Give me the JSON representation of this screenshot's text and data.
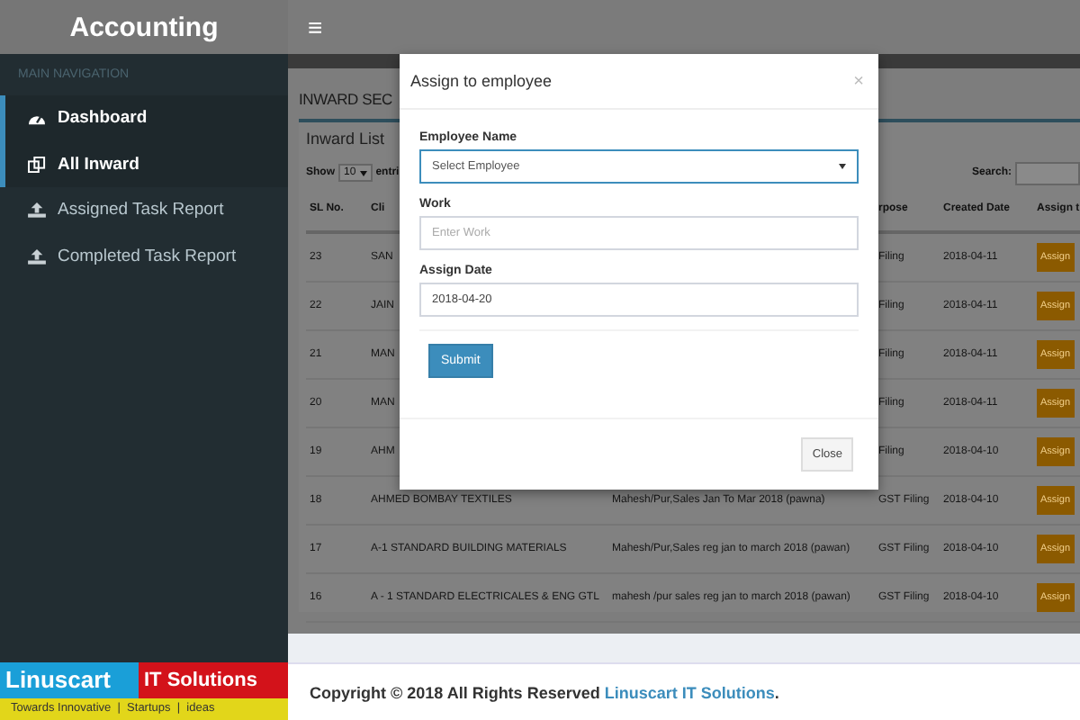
{
  "header": {
    "brand": "Accounting",
    "menu_icon": "≡"
  },
  "sidebar": {
    "heading": "MAIN NAVIGATION",
    "items": [
      {
        "label": "Dashboard",
        "selected": true
      },
      {
        "label": "All Inward",
        "selected": true
      },
      {
        "label": "Assigned Task Report",
        "selected": false
      },
      {
        "label": "Completed Task Report",
        "selected": false
      }
    ]
  },
  "logo": {
    "name": "Linuscart",
    "suffix": "IT Solutions",
    "tagline": "Towards Innovative  |  Startups  |  ideas"
  },
  "page": {
    "title": "INWARD SEC",
    "box_title": "Inward List",
    "show_label": "Show",
    "page_size": "10",
    "entries_label": "entri",
    "search_label": "Search:"
  },
  "table": {
    "columns": [
      "SL No.",
      "Cli",
      "",
      "rpose",
      "Created Date",
      "Assign t"
    ],
    "rows": [
      {
        "sl": "23",
        "client": "SAN",
        "purpose": "Filing",
        "date": "2018-04-11",
        "action": "Assign"
      },
      {
        "sl": "22",
        "client": "JAIN",
        "purpose": "Filing",
        "date": "2018-04-11",
        "action": "Assign"
      },
      {
        "sl": "21",
        "client": "MAN",
        "purpose": "Filing",
        "date": "2018-04-11",
        "action": "Assign"
      },
      {
        "sl": "20",
        "client": "MAN",
        "purpose": "Filing",
        "date": "2018-04-11",
        "action": "Assign"
      },
      {
        "sl": "19",
        "client": "AHM",
        "purpose": "Filing",
        "date": "2018-04-10",
        "action": "Assign"
      },
      {
        "sl": "18",
        "client": "AHMED BOMBAY TEXTILES",
        "work": "Mahesh/Pur,Sales Jan To Mar 2018 (pawna)",
        "purpose": "GST Filing",
        "date": "2018-04-10",
        "action": "Assign"
      },
      {
        "sl": "17",
        "client": "A-1 STANDARD BUILDING MATERIALS",
        "work": "Mahesh/Pur,Sales reg jan to march 2018 (pawan)",
        "purpose": "GST Filing",
        "date": "2018-04-10",
        "action": "Assign"
      },
      {
        "sl": "16",
        "client": "A - 1 STANDARD ELECTRICALES & ENG GTL",
        "work": "mahesh /pur sales reg jan to march 2018 (pawan)",
        "purpose": "GST Filing",
        "date": "2018-04-10",
        "action": "Assign"
      }
    ]
  },
  "modal": {
    "title": "Assign to employee",
    "close_icon": "×",
    "fields": [
      {
        "label": "Employee Name",
        "kind": "select",
        "placeholder": "Select Employee",
        "focused": true
      },
      {
        "label": "Work",
        "kind": "text",
        "placeholder": "Enter Work",
        "focused": false
      },
      {
        "label": "Assign Date",
        "kind": "text",
        "value": "2018-04-20",
        "focused": false
      }
    ],
    "submit": "Submit",
    "close": "Close"
  },
  "footer": {
    "text": "Copyright © 2018 All Rights Reserved ",
    "link": "Linuscart IT Solutions",
    "end": "."
  }
}
